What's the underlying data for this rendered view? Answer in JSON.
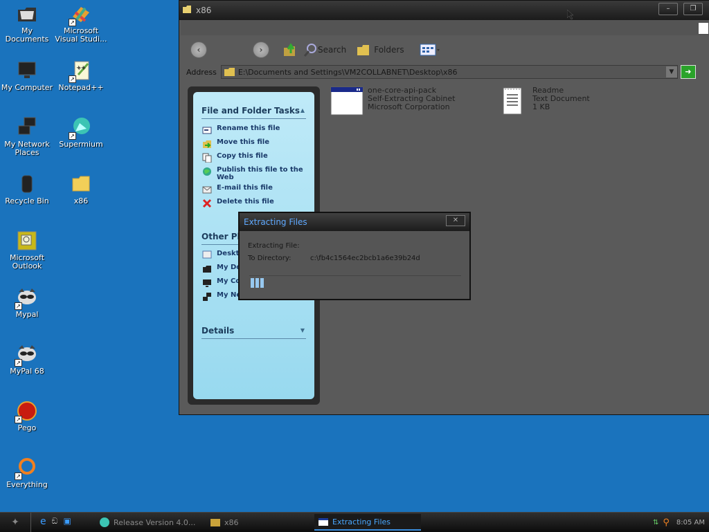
{
  "desktop": {
    "icons": [
      {
        "label": "My Documents",
        "icon": "folder-docs"
      },
      {
        "label": "Microsoft Visual Studi...",
        "icon": "visual-studio"
      },
      {
        "label": "My Computer",
        "icon": "monitor"
      },
      {
        "label": "Notepad++",
        "icon": "notepadpp"
      },
      {
        "label": "My Network Places",
        "icon": "network"
      },
      {
        "label": "Supermium",
        "icon": "browser"
      },
      {
        "label": "Recycle Bin",
        "icon": "trash"
      },
      {
        "label": "x86",
        "icon": "folder"
      },
      {
        "label": "Microsoft Outlook",
        "icon": "outlook"
      },
      {
        "label": "Mypal",
        "icon": "raccoon"
      },
      {
        "label": "MyPal 68",
        "icon": "raccoon"
      },
      {
        "label": "Pego",
        "icon": "pego"
      },
      {
        "label": "Everything",
        "icon": "everything"
      }
    ]
  },
  "explorer": {
    "title": "x86",
    "toolbar": {
      "search": "Search",
      "folders": "Folders"
    },
    "address": {
      "label": "Address",
      "value": "E:\\Documents and Settings\\VM2COLLABNET\\Desktop\\x86"
    },
    "tasks": {
      "heading": "File and Folder Tasks",
      "items": [
        "Rename this file",
        "Move this file",
        "Copy this file",
        "Publish this file to the Web",
        "E-mail this file",
        "Delete this file"
      ]
    },
    "other_places": {
      "heading": "Other Pla",
      "items": [
        "Deskt",
        "My Do",
        "My Co",
        "My Ne"
      ]
    },
    "details": {
      "heading": "Details"
    },
    "files": [
      {
        "name": "one-core-api-pack",
        "type": "Self-Extracting Cabinet",
        "publisher": "Microsoft Corporation"
      },
      {
        "name": "Readme",
        "type": "Text Document",
        "size": "1 KB"
      }
    ]
  },
  "dialog": {
    "title": "Extracting Files",
    "extracting_label": "Extracting File:",
    "directory_label": "To Directory:",
    "directory_value": "c:\\fb4c1564ec2bcb1a6e39b24d",
    "progress_fraction": 0.08
  },
  "taskbar": {
    "buttons": [
      "Release Version 4.0...",
      "x86",
      "Extracting Files"
    ],
    "clock": "8:05 AM"
  },
  "colors": {
    "desktop": "#1a73bd",
    "dialog_title": "#5fa9ff",
    "taskpane": "#a8e0f2"
  }
}
